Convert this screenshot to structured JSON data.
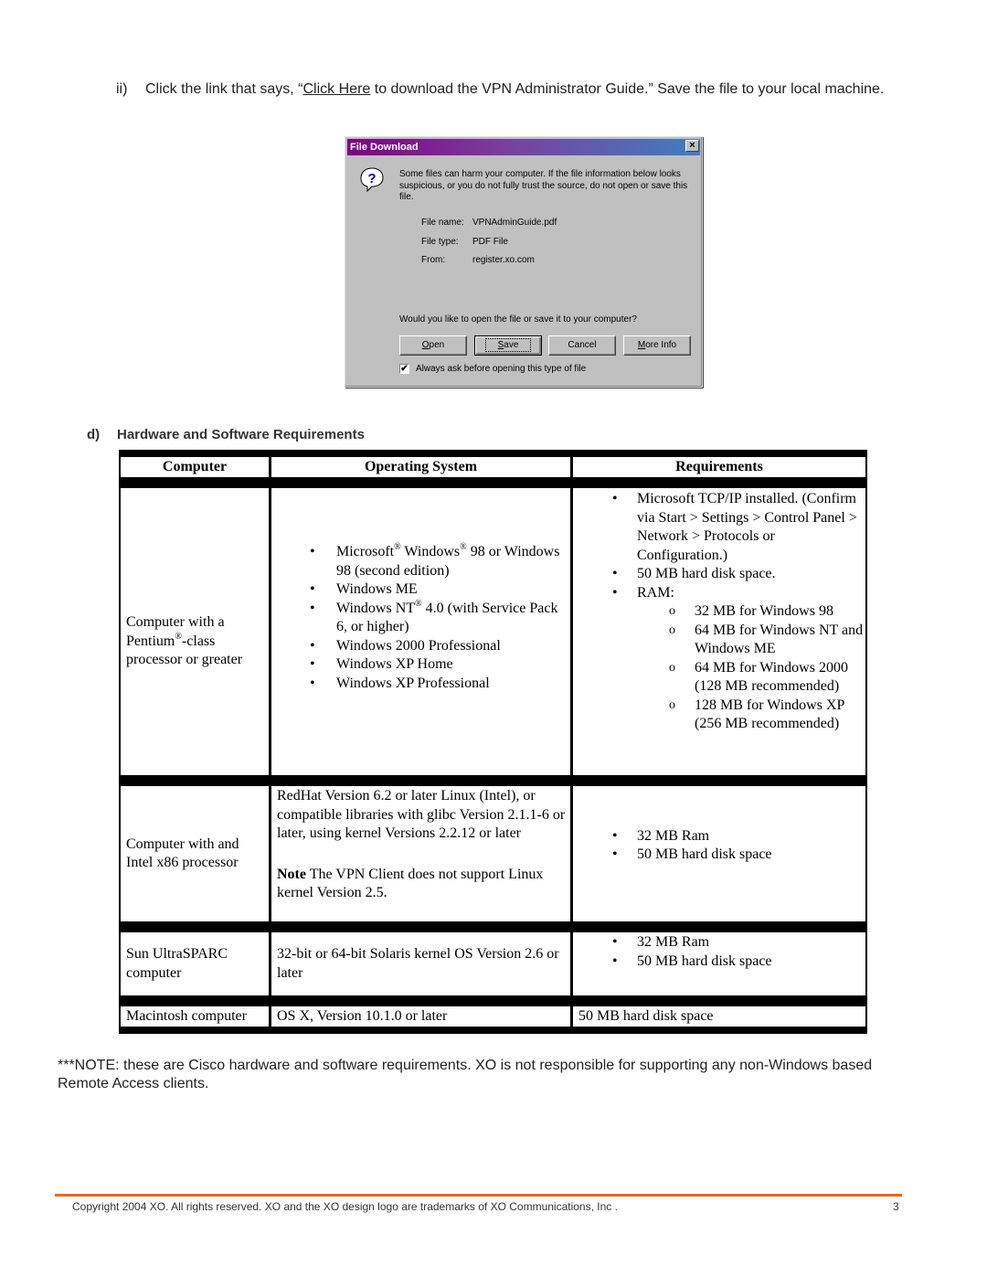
{
  "step": {
    "number": "ii)",
    "text_before": "Click the link that says, “",
    "link_text": "Click Here",
    "text_after": " to download the VPN Administrator Guide.” Save the file to your local machine."
  },
  "dialog": {
    "title": "File Download",
    "close_glyph": "×",
    "message": "Some files can harm your computer. If the file information below looks suspicious, or you do not fully trust the source, do not open or save this file.",
    "fields": [
      {
        "label": "File name:",
        "value": "VPNAdminGuide.pdf"
      },
      {
        "label": "File type:",
        "value": "PDF File"
      },
      {
        "label": "From:",
        "value": "register.xo.com"
      }
    ],
    "question": "Would you like to open the file or save it to your computer?",
    "buttons": {
      "open": {
        "mnemonic": "O",
        "rest": "pen"
      },
      "save": {
        "mnemonic": "S",
        "rest": "ave"
      },
      "cancel": "Cancel",
      "more_info": {
        "mnemonic": "M",
        "rest": "ore Info"
      }
    },
    "checkbox": {
      "checked": true,
      "glyph": "✔",
      "label": "Always ask before opening this type of file"
    }
  },
  "section": {
    "letter": "d)",
    "title": "Hardware and Software Requirements"
  },
  "table": {
    "headers": [
      "Computer",
      "Operating System",
      "Requirements"
    ],
    "rows": [
      {
        "computer": {
          "a": "Computer with a Pentium",
          "sup": "®",
          "b": "-class processor or greater"
        },
        "os": [
          {
            "t1": "Microsoft",
            "s1": "®",
            "t2": " Windows",
            "s2": "®",
            "t3": " 98 or Windows 98 (second edition)"
          },
          {
            "t1": "Windows ME"
          },
          {
            "t1": "Windows NT",
            "s1": "®",
            "t2": " 4.0 (with Service Pack 6, or higher)"
          },
          {
            "t1": "Windows 2000 Professional"
          },
          {
            "t1": "Windows XP Home"
          },
          {
            "t1": "Windows XP Professional"
          }
        ],
        "requirements": [
          "Microsoft TCP/IP installed. (Confirm via Start > Settings > Control Panel > Network > Protocols or Configuration.)",
          "50 MB hard disk space.",
          "RAM:"
        ],
        "ram": [
          "32 MB for Windows 98",
          "64 MB for Windows NT and Windows ME",
          "64 MB for Windows 2000 (128 MB recommended)",
          "128 MB for Windows XP (256 MB recommended)"
        ]
      },
      {
        "computer": "Computer with and Intel x86 processor",
        "os_text": "RedHat Version 6.2 or later Linux (Intel), or compatible libraries with glibc Version 2.1.1-6 or later, using kernel Versions 2.2.12 or later",
        "os_note_bold": "Note",
        "os_note": " The VPN Client does not support Linux kernel Version 2.5.",
        "requirements": [
          "32 MB Ram",
          "50 MB hard disk space"
        ]
      },
      {
        "computer": "Sun UltraSPARC computer",
        "os_text": "32-bit or 64-bit Solaris kernel OS Version 2.6 or later",
        "requirements": [
          "32 MB Ram",
          "50 MB hard disk space"
        ]
      },
      {
        "computer": "Macintosh computer",
        "os_text": "OS X, Version 10.1.0 or later",
        "requirements_text": "50 MB hard disk space"
      }
    ]
  },
  "note": "***NOTE: these are Cisco hardware and software requirements. XO is not responsible for supporting any non-Windows based Remote Access clients.",
  "footer": {
    "copyright": "Copyright 2004 XO. All rights reserved. XO and the XO design logo are trademarks of XO Communications, Inc .",
    "page_number": "3",
    "accent_color": "#f26b0f"
  }
}
